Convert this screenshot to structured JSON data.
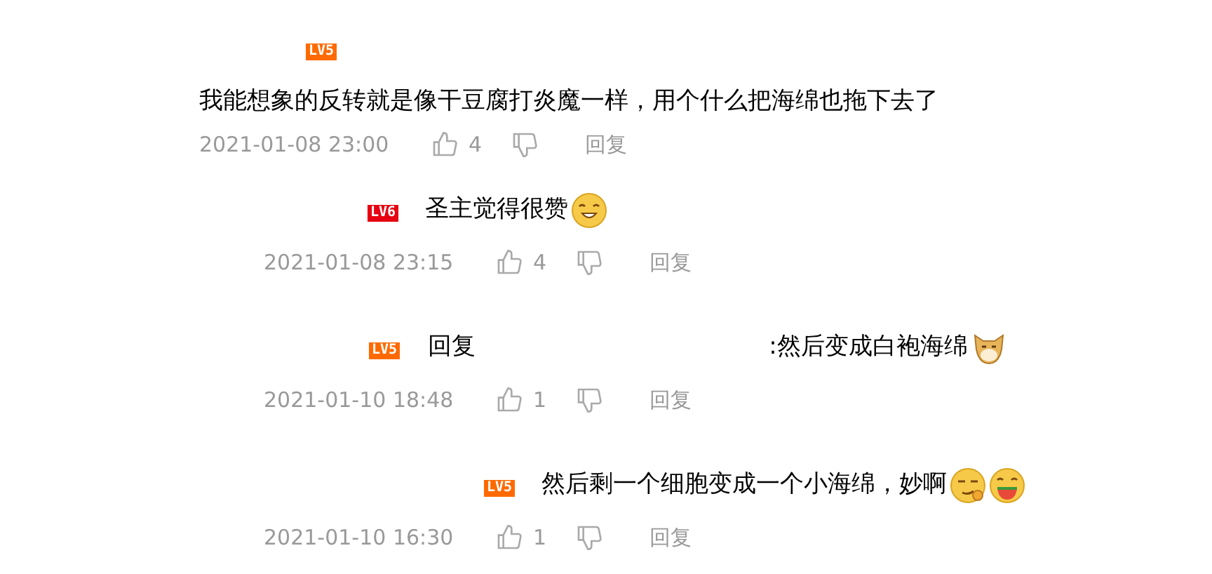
{
  "comment": {
    "level": "LV5",
    "color": "#ff6a00",
    "text": "我能想象的反转就是像干豆腐打炎魔一样，用个什么把海绵也拖下去了",
    "time": "2021-01-08 23:00",
    "likes": "4",
    "reply_label": "回复"
  },
  "replies": [
    {
      "level": "LV6",
      "color": "#e60012",
      "text": "圣主觉得很赞",
      "emojis": [
        {
          "kind": "grin"
        }
      ],
      "time": "2021-01-08 23:15",
      "likes": "4",
      "reply_label": "回复"
    },
    {
      "level": "LV5",
      "color": "#ff6a00",
      "prefix": "回复",
      "text": ":然后变成白袍海绵",
      "emojis": [
        {
          "kind": "dog"
        }
      ],
      "time": "2021-01-10 18:48",
      "likes": "1",
      "reply_label": "回复"
    },
    {
      "level": "LV5",
      "color": "#ff6a00",
      "text": "然后剩一个细胞变成一个小海绵，妙啊",
      "emojis": [
        {
          "kind": "smirk"
        },
        {
          "kind": "eating"
        }
      ],
      "time": "2021-01-10 16:30",
      "likes": "1",
      "reply_label": "回复"
    }
  ]
}
